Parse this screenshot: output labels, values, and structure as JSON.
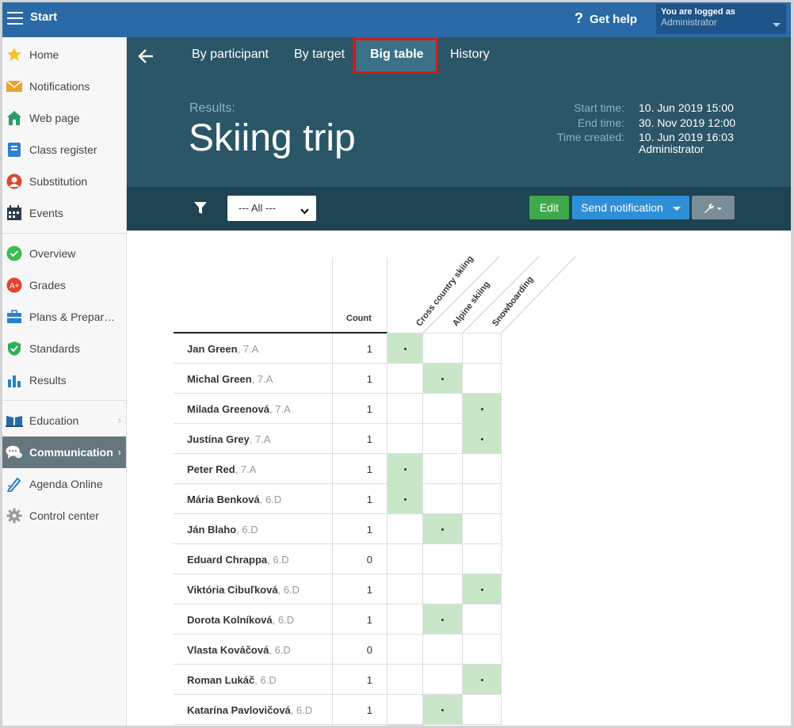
{
  "topbar": {
    "title": "Start",
    "help": "Get help",
    "help_icon": "?",
    "user_label": "You are logged as",
    "user_name": "Administrator"
  },
  "sidebar": {
    "items": [
      {
        "label": "Home",
        "icon": "star-icon"
      },
      {
        "label": "Notifications",
        "icon": "envelope-icon"
      },
      {
        "label": "Web page",
        "icon": "house-icon"
      },
      {
        "label": "Class register",
        "icon": "register-icon"
      },
      {
        "label": "Substitution",
        "icon": "substitution-icon"
      },
      {
        "label": "Events",
        "icon": "calendar-icon"
      },
      {
        "label": "Overview",
        "icon": "check-circle-icon"
      },
      {
        "label": "Grades",
        "icon": "grades-icon"
      },
      {
        "label": "Plans & Prepar…",
        "icon": "briefcase-icon"
      },
      {
        "label": "Standards",
        "icon": "shield-icon"
      },
      {
        "label": "Results",
        "icon": "bar-chart-icon"
      },
      {
        "label": "Education",
        "icon": "book-icon"
      },
      {
        "label": "Communication",
        "icon": "chat-icon"
      },
      {
        "label": "Agenda Online",
        "icon": "pen-icon"
      },
      {
        "label": "Control center",
        "icon": "gear-icon"
      }
    ]
  },
  "tabs": {
    "by_participant": "By participant",
    "by_target": "By target",
    "big_table": "Big table",
    "history": "History"
  },
  "header": {
    "results_label": "Results:",
    "title": "Skiing trip",
    "start_label": "Start time:",
    "start_value": "10. Jun 2019 15:00",
    "end_label": "End time:",
    "end_value": "30. Nov 2019 12:00",
    "created_label": "Time created:",
    "created_value": "10. Jun 2019 16:03",
    "created_by": "Administrator"
  },
  "toolbar": {
    "filter_value": "--- All ---",
    "edit": "Edit",
    "send": "Send notification"
  },
  "table": {
    "count_header": "Count",
    "columns": [
      "Cross country skiing",
      "Alpine skiing",
      "Snowboarding"
    ],
    "rows": [
      {
        "name": "Jan Green",
        "cls": ", 7.A",
        "count": "1",
        "col": 0
      },
      {
        "name": "Michal Green",
        "cls": ", 7.A",
        "count": "1",
        "col": 1
      },
      {
        "name": "Milada Greenová",
        "cls": ", 7.A",
        "count": "1",
        "col": 2
      },
      {
        "name": "Justína Grey",
        "cls": ", 7.A",
        "count": "1",
        "col": 2
      },
      {
        "name": "Peter Red",
        "cls": ", 7.A",
        "count": "1",
        "col": 0
      },
      {
        "name": "Mária Benková",
        "cls": ", 6.D",
        "count": "1",
        "col": 0
      },
      {
        "name": "Ján Blaho",
        "cls": ", 6.D",
        "count": "1",
        "col": 1
      },
      {
        "name": "Eduard Chrappa",
        "cls": ", 6.D",
        "count": "0",
        "col": -1
      },
      {
        "name": "Viktória Cibuľková",
        "cls": ", 6.D",
        "count": "1",
        "col": 2
      },
      {
        "name": "Dorota Kolníková",
        "cls": ", 6.D",
        "count": "1",
        "col": 1
      },
      {
        "name": "Vlasta Kováčová",
        "cls": ", 6.D",
        "count": "0",
        "col": -1
      },
      {
        "name": "Roman Lukáč",
        "cls": ", 6.D",
        "count": "1",
        "col": 2
      },
      {
        "name": "Katarína Pavlovičová",
        "cls": ", 6.D",
        "count": "1",
        "col": 1
      }
    ]
  },
  "colors": {
    "topbar": "#2b6aa8",
    "header": "#2a5668",
    "toolbar": "#1e4351",
    "mark": "#c9e6c9",
    "highlight": "#cc1c1c"
  }
}
